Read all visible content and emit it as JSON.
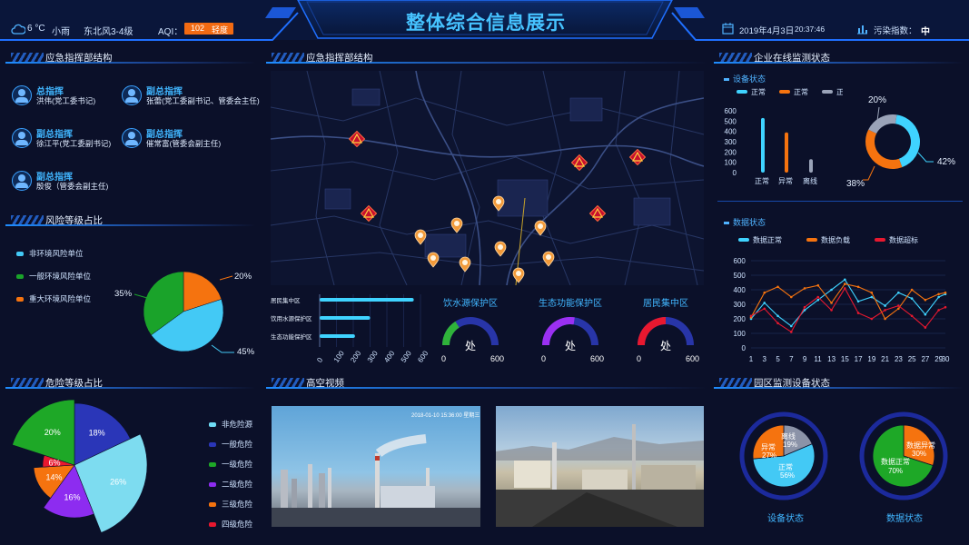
{
  "header": {
    "title": "整体综合信息展示",
    "weather": {
      "temp": "6 °C",
      "condition": "小雨",
      "wind": "东北风3-4级"
    },
    "aqi": {
      "label": "AQI：",
      "value": "102",
      "level": "轻度"
    },
    "datetime": {
      "date": "2019年4月3日",
      "time": "20:37:46"
    },
    "pollution": {
      "label": "污染指数：",
      "value": "中"
    }
  },
  "panels": {
    "org": "应急指挥部结构",
    "map": "应急指挥部结构",
    "risk": "风险等级占比",
    "danger": "危险等级占比",
    "video": "高空视频",
    "enterprise": "企业在线监测状态",
    "park": "园区监测设备状态"
  },
  "org": [
    {
      "role": "总指挥",
      "name": "洪伟(党工委书记)"
    },
    {
      "role": "副总指挥",
      "name": "张蕾(党工委副书记、管委会主任)"
    },
    {
      "role": "副总指挥",
      "name": "徐江平(党工委副书记)"
    },
    {
      "role": "副总指挥",
      "name": "催常富(管委会副主任)"
    },
    {
      "role": "副总指挥",
      "name": "殷俊（管委会副主任)"
    }
  ],
  "risk": {
    "legend": [
      "非环境风险单位",
      "一般环境风险单位",
      "重大环境风险单位"
    ],
    "colors": [
      "#43c9f5",
      "#1aa32a",
      "#f5730f"
    ],
    "values": [
      45,
      35,
      20
    ],
    "labels": [
      "45%",
      "35%",
      "20%"
    ]
  },
  "danger": {
    "legend": [
      "非危险源",
      "一般危险",
      "一级危险",
      "二级危险",
      "三级危险",
      "四级危险"
    ],
    "colors": [
      "#6fdcf5",
      "#2a36b8",
      "#1ea827",
      "#8d2cf0",
      "#f5730f",
      "#e8182f"
    ],
    "slices": [
      {
        "label": "18%",
        "value": 18,
        "color": "#2a36b8"
      },
      {
        "label": "26%",
        "value": 26,
        "color": "#7ddcf0"
      },
      {
        "label": "16%",
        "value": 16,
        "color": "#8d2cf0"
      },
      {
        "label": "14%",
        "value": 14,
        "color": "#f5730f"
      },
      {
        "label": "6%",
        "value": 6,
        "color": "#e8182f"
      },
      {
        "label": "20%",
        "value": 20,
        "color": "#1ea827"
      }
    ]
  },
  "map_bars": {
    "categories": [
      "居民集中区",
      "饮用水源保护区",
      "生态功能保护区"
    ],
    "values": [
      560,
      300,
      210
    ],
    "ticks": [
      "0",
      "100",
      "200",
      "300",
      "400",
      "500",
      "600"
    ]
  },
  "gauges": [
    {
      "title": "饮水源保护区",
      "unit": "处",
      "min": "0",
      "max": "600",
      "color": "#2fb33a",
      "fraction": 0.32
    },
    {
      "title": "生态功能保护区",
      "unit": "处",
      "min": "0",
      "max": "600",
      "color": "#9b30f2",
      "fraction": 0.55
    },
    {
      "title": "居民集中区",
      "unit": "处",
      "min": "0",
      "max": "600",
      "color": "#e8182f",
      "fraction": 0.5
    }
  ],
  "videos": [
    {
      "overlay": "2018-01-10 15:36:00 星期三"
    },
    {
      "overlay": ""
    }
  ],
  "enterprise": {
    "device_title": "设备状态",
    "device_legend": [
      "正常",
      "正常",
      "正常"
    ],
    "device_legend_colors": [
      "#3fd3ff",
      "#f5730f",
      "#9aa3b8"
    ],
    "device_categories": [
      "正常",
      "异常",
      "离线"
    ],
    "device_values": [
      530,
      390,
      130
    ],
    "device_ticks": [
      "600",
      "500",
      "400",
      "300",
      "200",
      "100",
      "0"
    ],
    "donut": [
      {
        "label": "42%",
        "value": 42,
        "color": "#3fd3ff"
      },
      {
        "label": "38%",
        "value": 38,
        "color": "#f5730f"
      },
      {
        "label": "20%",
        "value": 20,
        "color": "#9aa3b8"
      }
    ],
    "data_title": "数据状态",
    "data_legend": [
      "数据正常",
      "数据负载",
      "数据超标"
    ],
    "data_colors": [
      "#3fd3ff",
      "#f5730f",
      "#e8182f"
    ],
    "data_ticks_y": [
      "600",
      "500",
      "400",
      "300",
      "200",
      "100",
      "0"
    ],
    "data_x": [
      1,
      3,
      5,
      7,
      9,
      11,
      13,
      15,
      17,
      19,
      21,
      23,
      25,
      27,
      29,
      30
    ]
  },
  "chart_data": {
    "type": "line",
    "title": "数据状态",
    "x": [
      1,
      3,
      5,
      7,
      9,
      11,
      13,
      15,
      17,
      19,
      21,
      23,
      25,
      27,
      29,
      30
    ],
    "ylim": [
      0,
      600
    ],
    "series": [
      {
        "name": "数据正常",
        "values": [
          200,
          310,
          220,
          150,
          260,
          330,
          400,
          470,
          320,
          350,
          290,
          380,
          340,
          230,
          350,
          370
        ]
      },
      {
        "name": "数据负载",
        "values": [
          210,
          380,
          420,
          350,
          410,
          430,
          310,
          440,
          420,
          380,
          200,
          270,
          400,
          330,
          370,
          380
        ]
      },
      {
        "name": "数据超标",
        "values": [
          220,
          270,
          170,
          110,
          280,
          350,
          260,
          410,
          240,
          200,
          260,
          290,
          220,
          140,
          260,
          280
        ]
      }
    ]
  },
  "park": {
    "device_label": "设备状态",
    "data_label": "数据状态",
    "device_ring": [
      {
        "label": "离线",
        "pct": "19%",
        "value": 19,
        "color": "#8b93a8"
      },
      {
        "label": "正常",
        "pct": "56%",
        "value": 56,
        "color": "#43c9f5"
      },
      {
        "label": "异常",
        "pct": "27%",
        "value": 27,
        "color": "#f5730f"
      }
    ],
    "data_ring": [
      {
        "label": "数据异常",
        "pct": "30%",
        "value": 30,
        "color": "#f5730f"
      },
      {
        "label": "数据正常",
        "pct": "70%",
        "value": 70,
        "color": "#1ea827"
      }
    ]
  }
}
